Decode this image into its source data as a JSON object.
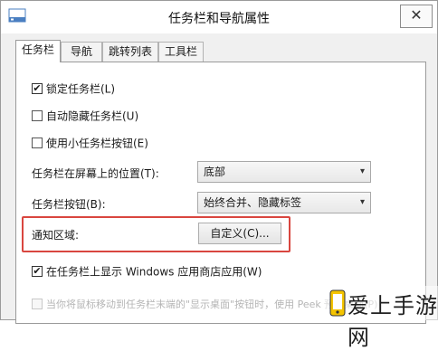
{
  "window": {
    "title": "任务栏和导航属性",
    "close_glyph": "✕"
  },
  "tabs": [
    {
      "label": "任务栏",
      "active": true
    },
    {
      "label": "导航",
      "active": false
    },
    {
      "label": "跳转列表",
      "active": false
    },
    {
      "label": "工具栏",
      "active": false
    }
  ],
  "options": {
    "lock_taskbar": {
      "label": "锁定任务栏(L)",
      "checked": true
    },
    "auto_hide": {
      "label": "自动隐藏任务栏(U)",
      "checked": false
    },
    "small_buttons": {
      "label": "使用小任务栏按钮(E)",
      "checked": false
    },
    "show_store_apps": {
      "label": "在任务栏上显示 Windows 应用商店应用(W)",
      "checked": true
    },
    "peek": {
      "label": "当你将鼠标移动到任务栏末端的\"显示桌面\"按钮时，使用 Peek 预览桌面(P)",
      "checked": false,
      "disabled": true
    }
  },
  "position": {
    "label": "任务栏在屏幕上的位置(T):",
    "value": "底部"
  },
  "buttons_setting": {
    "label": "任务栏按钮(B):",
    "value": "始终合并、隐藏标签"
  },
  "notification": {
    "label": "通知区域:",
    "customize_label": "自定义(C)..."
  },
  "watermark": {
    "text": "爱上手游网"
  },
  "colors": {
    "highlight": "#d9463f",
    "accent": "#2b6cc4"
  }
}
